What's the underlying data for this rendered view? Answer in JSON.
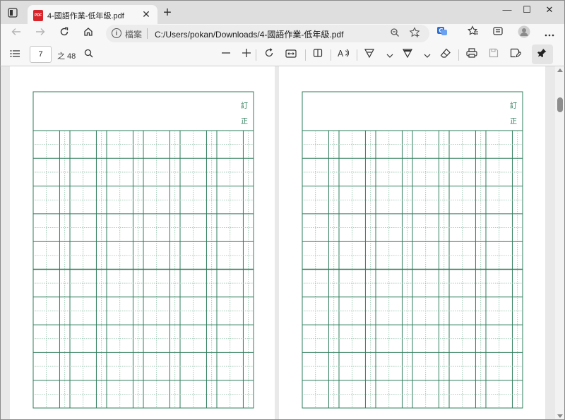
{
  "browser": {
    "tab_title": "4-國語作業-低年級.pdf",
    "tab_icon_label": "PDF",
    "tab_close_glyph": "✕",
    "new_tab_glyph": "+",
    "window_controls": {
      "minimize": "—",
      "maximize": "☐",
      "close": "✕"
    }
  },
  "addressbar": {
    "file_label": "檔案",
    "url": "C:/Users/pokan/Downloads/4-國語作業-低年級.pdf"
  },
  "pdf_toolbar": {
    "current_page": "7",
    "total_pages": "之 48"
  },
  "worksheet": {
    "correction_label": [
      "訂",
      "正"
    ],
    "grid_color": "#2e7d5b",
    "dotted_color": "#8fbfa8",
    "columns": 6,
    "rows": 10
  },
  "icons": {
    "sidebar": "list-icon",
    "search": "search-icon",
    "zoom_out": "minus-icon",
    "zoom_in": "plus-icon",
    "rotate": "rotate-icon",
    "fit": "fit-width-icon",
    "page_view": "page-view-icon",
    "read_aloud": "read-aloud-icon",
    "draw": "draw-icon",
    "highlight": "highlight-icon",
    "erase": "eraser-icon",
    "print": "print-icon",
    "save": "save-icon",
    "save_as": "save-as-icon",
    "pin": "pin-icon"
  },
  "colors": {
    "grid": "#2e7d5b",
    "pdf_icon": "#d8252b",
    "tab_bg": "#f7f7f7",
    "strip_bg": "#dedede"
  }
}
